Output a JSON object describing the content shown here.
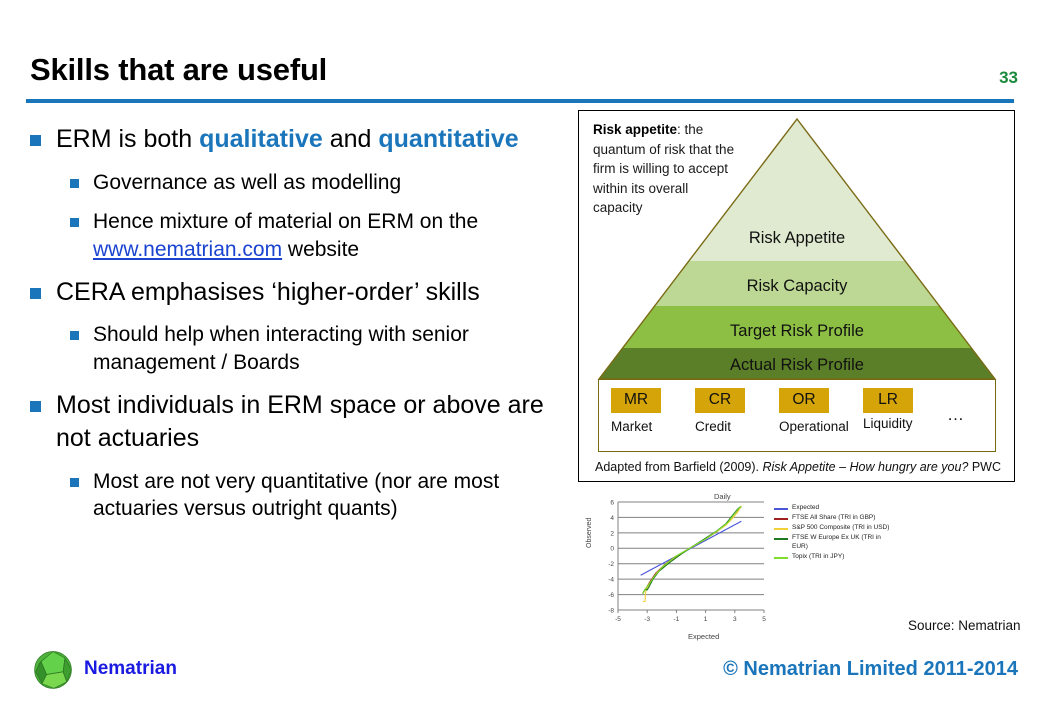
{
  "slide": {
    "title": "Skills that are useful",
    "page_number": "33",
    "accent_color": "#1a75bb",
    "page_number_color": "#1a8a3c"
  },
  "bullets": [
    {
      "level": 1,
      "parts": [
        {
          "text": "ERM is both ",
          "style": "plain"
        },
        {
          "text": "qualitative",
          "style": "highlight"
        },
        {
          "text": " and ",
          "style": "plain"
        },
        {
          "text": "quantitative",
          "style": "highlight"
        }
      ]
    },
    {
      "level": 2,
      "parts": [
        {
          "text": "Governance as well as modelling",
          "style": "plain"
        }
      ]
    },
    {
      "level": 2,
      "parts": [
        {
          "text": "Hence mixture of material on ERM on the ",
          "style": "plain"
        },
        {
          "text": "www.nematrian.com",
          "style": "link"
        },
        {
          "text": " website",
          "style": "plain"
        }
      ]
    },
    {
      "level": 1,
      "parts": [
        {
          "text": "CERA emphasises ‘higher-order’ skills",
          "style": "plain"
        }
      ]
    },
    {
      "level": 2,
      "parts": [
        {
          "text": "Should help when interacting with senior management / Boards",
          "style": "plain"
        }
      ]
    },
    {
      "level": 1,
      "parts": [
        {
          "text": "Most individuals in ERM space or above are not actuaries",
          "style": "plain"
        }
      ]
    },
    {
      "level": 2,
      "parts": [
        {
          "text": "Most are not very quantitative (nor are most actuaries versus outright quants)",
          "style": "plain"
        }
      ]
    }
  ],
  "diagram": {
    "callout": {
      "lead": "Risk appetite",
      "body": ": the quantum of risk that the firm is willing to accept within its overall capacity"
    },
    "pyramid_bands": [
      {
        "label": "Risk Appetite",
        "color": "#dfead0"
      },
      {
        "label": "Risk Capacity",
        "color": "#bdd894"
      },
      {
        "label": "Target Risk Profile",
        "color": "#8cbf44"
      },
      {
        "label": "Actual Risk Profile",
        "color": "#5b7f28"
      }
    ],
    "risk_categories": [
      {
        "code": "MR",
        "name": "Market"
      },
      {
        "code": "CR",
        "name": "Credit"
      },
      {
        "code": "OR",
        "name": "Operational"
      },
      {
        "code": "LR",
        "name": "Liquidity"
      }
    ],
    "risk_more": "…",
    "chip_color": "#d4a408",
    "attribution": {
      "prefix": "Adapted from Barfield (2009). ",
      "italic": "Risk Appetite – How hungry are you?",
      "suffix": " PWC"
    }
  },
  "chart_data": {
    "type": "line",
    "title": "Daily",
    "xlabel": "Expected",
    "ylabel": "Observed",
    "xlim": [
      -5,
      5
    ],
    "ylim": [
      -8,
      6
    ],
    "xticks": [
      "-5",
      "-3",
      "-1",
      "1",
      "3",
      "5"
    ],
    "yticks": [
      "6",
      "4",
      "2",
      "0",
      "-2",
      "-4",
      "-6",
      "-8"
    ],
    "grid": true,
    "legend_position": "right",
    "series": [
      {
        "name": "Expected",
        "color": "#4a55d8",
        "x": [
          -3.45,
          3.45
        ],
        "y": [
          -3.5,
          3.5
        ]
      },
      {
        "name": "FTSE All Share (TRI in GBP)",
        "color": "#a02020",
        "x": [
          -3.3,
          -3.05,
          -2.8,
          -2.4,
          -1.8,
          -1.0,
          0.0,
          1.0,
          1.8,
          2.4,
          2.9,
          3.2,
          3.45
        ],
        "y": [
          -5.8,
          -5.1,
          -4.3,
          -3.2,
          -2.1,
          -1.0,
          0.1,
          1.2,
          2.2,
          3.1,
          4.3,
          4.9,
          5.4
        ]
      },
      {
        "name": "S&P 500 Composite (TRI in USD)",
        "color": "#f2d03a",
        "x": [
          -3.3,
          -3.15,
          -3.1,
          -3.0,
          -2.7,
          -2.3,
          -1.6,
          -0.8,
          0.0,
          0.9,
          1.7,
          2.4,
          2.9,
          3.2,
          3.45
        ],
        "y": [
          -6.9,
          -6.9,
          -5.5,
          -5.2,
          -4.2,
          -3.1,
          -2.0,
          -0.9,
          0.1,
          1.1,
          2.1,
          3.0,
          4.0,
          4.7,
          5.5
        ]
      },
      {
        "name": "FTSE W Europe Ex UK (TRI in EUR)",
        "color": "#1f7a1f",
        "x": [
          -3.3,
          -3.15,
          -3.0,
          -2.85,
          -2.6,
          -2.2,
          -1.5,
          -0.7,
          0.0,
          0.9,
          1.8,
          2.4,
          2.9,
          3.2,
          3.4
        ],
        "y": [
          -5.9,
          -5.3,
          -5.4,
          -4.9,
          -4.0,
          -3.0,
          -1.9,
          -0.8,
          0.1,
          1.2,
          2.3,
          3.2,
          4.4,
          5.1,
          5.4
        ]
      },
      {
        "name": "Topix (TRI in JPY)",
        "color": "#7ede2a",
        "x": [
          -3.3,
          -3.1,
          -2.9,
          -2.5,
          -1.9,
          -1.1,
          0.0,
          1.0,
          1.9,
          2.5,
          3.0,
          3.3,
          3.45
        ],
        "y": [
          -5.9,
          -5.2,
          -4.7,
          -3.6,
          -2.3,
          -1.1,
          0.1,
          1.2,
          2.4,
          3.3,
          4.5,
          5.2,
          5.4
        ]
      }
    ]
  },
  "source_note": "Source: Nematrian",
  "footer": {
    "brand": "Nematrian",
    "copyright": "© Nematrian Limited 2011-2014",
    "brand_color": "#1a1ae0",
    "copyright_color": "#1a75bb"
  }
}
